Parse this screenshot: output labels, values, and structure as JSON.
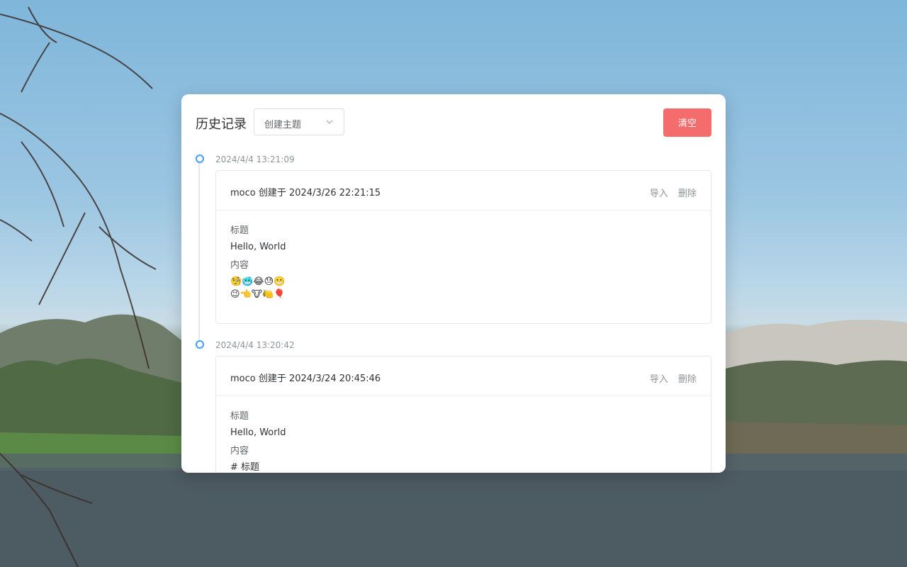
{
  "header": {
    "title": "历史记录",
    "select_value": "创建主题",
    "clear_label": "清空"
  },
  "entries": [
    {
      "timestamp": "2024/4/4 13:21:09",
      "author_line": "moco 创建于 2024/3/26 22:21:15",
      "import_label": "导入",
      "delete_label": "删除",
      "title_label": "标题",
      "title_value": "Hello, World",
      "content_label": "内容",
      "content_line1": "🧐🥶😂😓😬",
      "content_line2": "😉👈🐮🍋🎈"
    },
    {
      "timestamp": "2024/4/4 13:20:42",
      "author_line": "moco 创建于 2024/3/24 20:45:46",
      "import_label": "导入",
      "delete_label": "删除",
      "title_label": "标题",
      "title_value": "Hello, World",
      "content_label": "内容",
      "content_line1": "# 标题"
    }
  ],
  "colors": {
    "danger": "#f56c6c",
    "timeline_dot": "#409eff"
  }
}
